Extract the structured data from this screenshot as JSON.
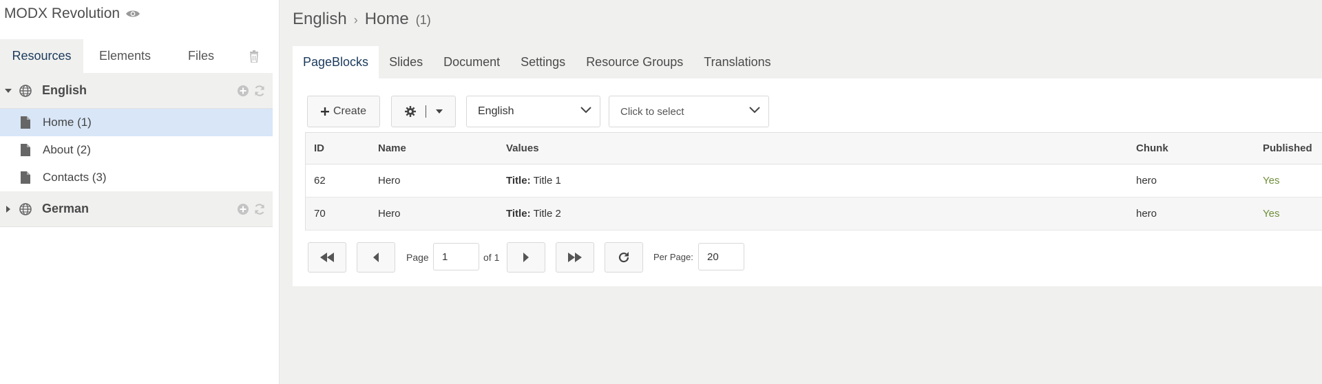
{
  "app": {
    "title": "MODX Revolution"
  },
  "sidebar": {
    "tabs": [
      {
        "label": "Resources",
        "active": true
      },
      {
        "label": "Elements",
        "active": false
      },
      {
        "label": "Files",
        "active": false
      }
    ],
    "tree": [
      {
        "type": "context",
        "label": "English",
        "expanded": true,
        "children": [
          {
            "label": "Home (1)",
            "selected": true
          },
          {
            "label": "About (2)",
            "selected": false
          },
          {
            "label": "Contacts (3)",
            "selected": false
          }
        ]
      },
      {
        "type": "context",
        "label": "German",
        "expanded": false,
        "children": []
      }
    ]
  },
  "breadcrumb": {
    "parent": "English",
    "current": "Home",
    "count": "(1)"
  },
  "main_tabs": [
    {
      "label": "PageBlocks",
      "active": true
    },
    {
      "label": "Slides",
      "active": false
    },
    {
      "label": "Document",
      "active": false
    },
    {
      "label": "Settings",
      "active": false
    },
    {
      "label": "Resource Groups",
      "active": false
    },
    {
      "label": "Translations",
      "active": false
    }
  ],
  "toolbar": {
    "create_label": "Create",
    "language_select": "English",
    "filter_select": "Click to select"
  },
  "grid": {
    "columns": [
      "ID",
      "Name",
      "Values",
      "Chunk",
      "Published"
    ],
    "rows": [
      {
        "id": "62",
        "name": "Hero",
        "value_key": "Title:",
        "value_text": "Title 1",
        "chunk": "hero",
        "published": "Yes"
      },
      {
        "id": "70",
        "name": "Hero",
        "value_key": "Title:",
        "value_text": "Title 2",
        "chunk": "hero",
        "published": "Yes"
      }
    ]
  },
  "pager": {
    "page_label": "Page",
    "page_value": "1",
    "of_label": "of 1",
    "per_page_label": "Per Page:",
    "per_page_value": "20"
  },
  "colors": {
    "selected_row": "#d8e6f7",
    "published_yes": "#6f8e3a",
    "accent_text": "#1b3a5c"
  }
}
